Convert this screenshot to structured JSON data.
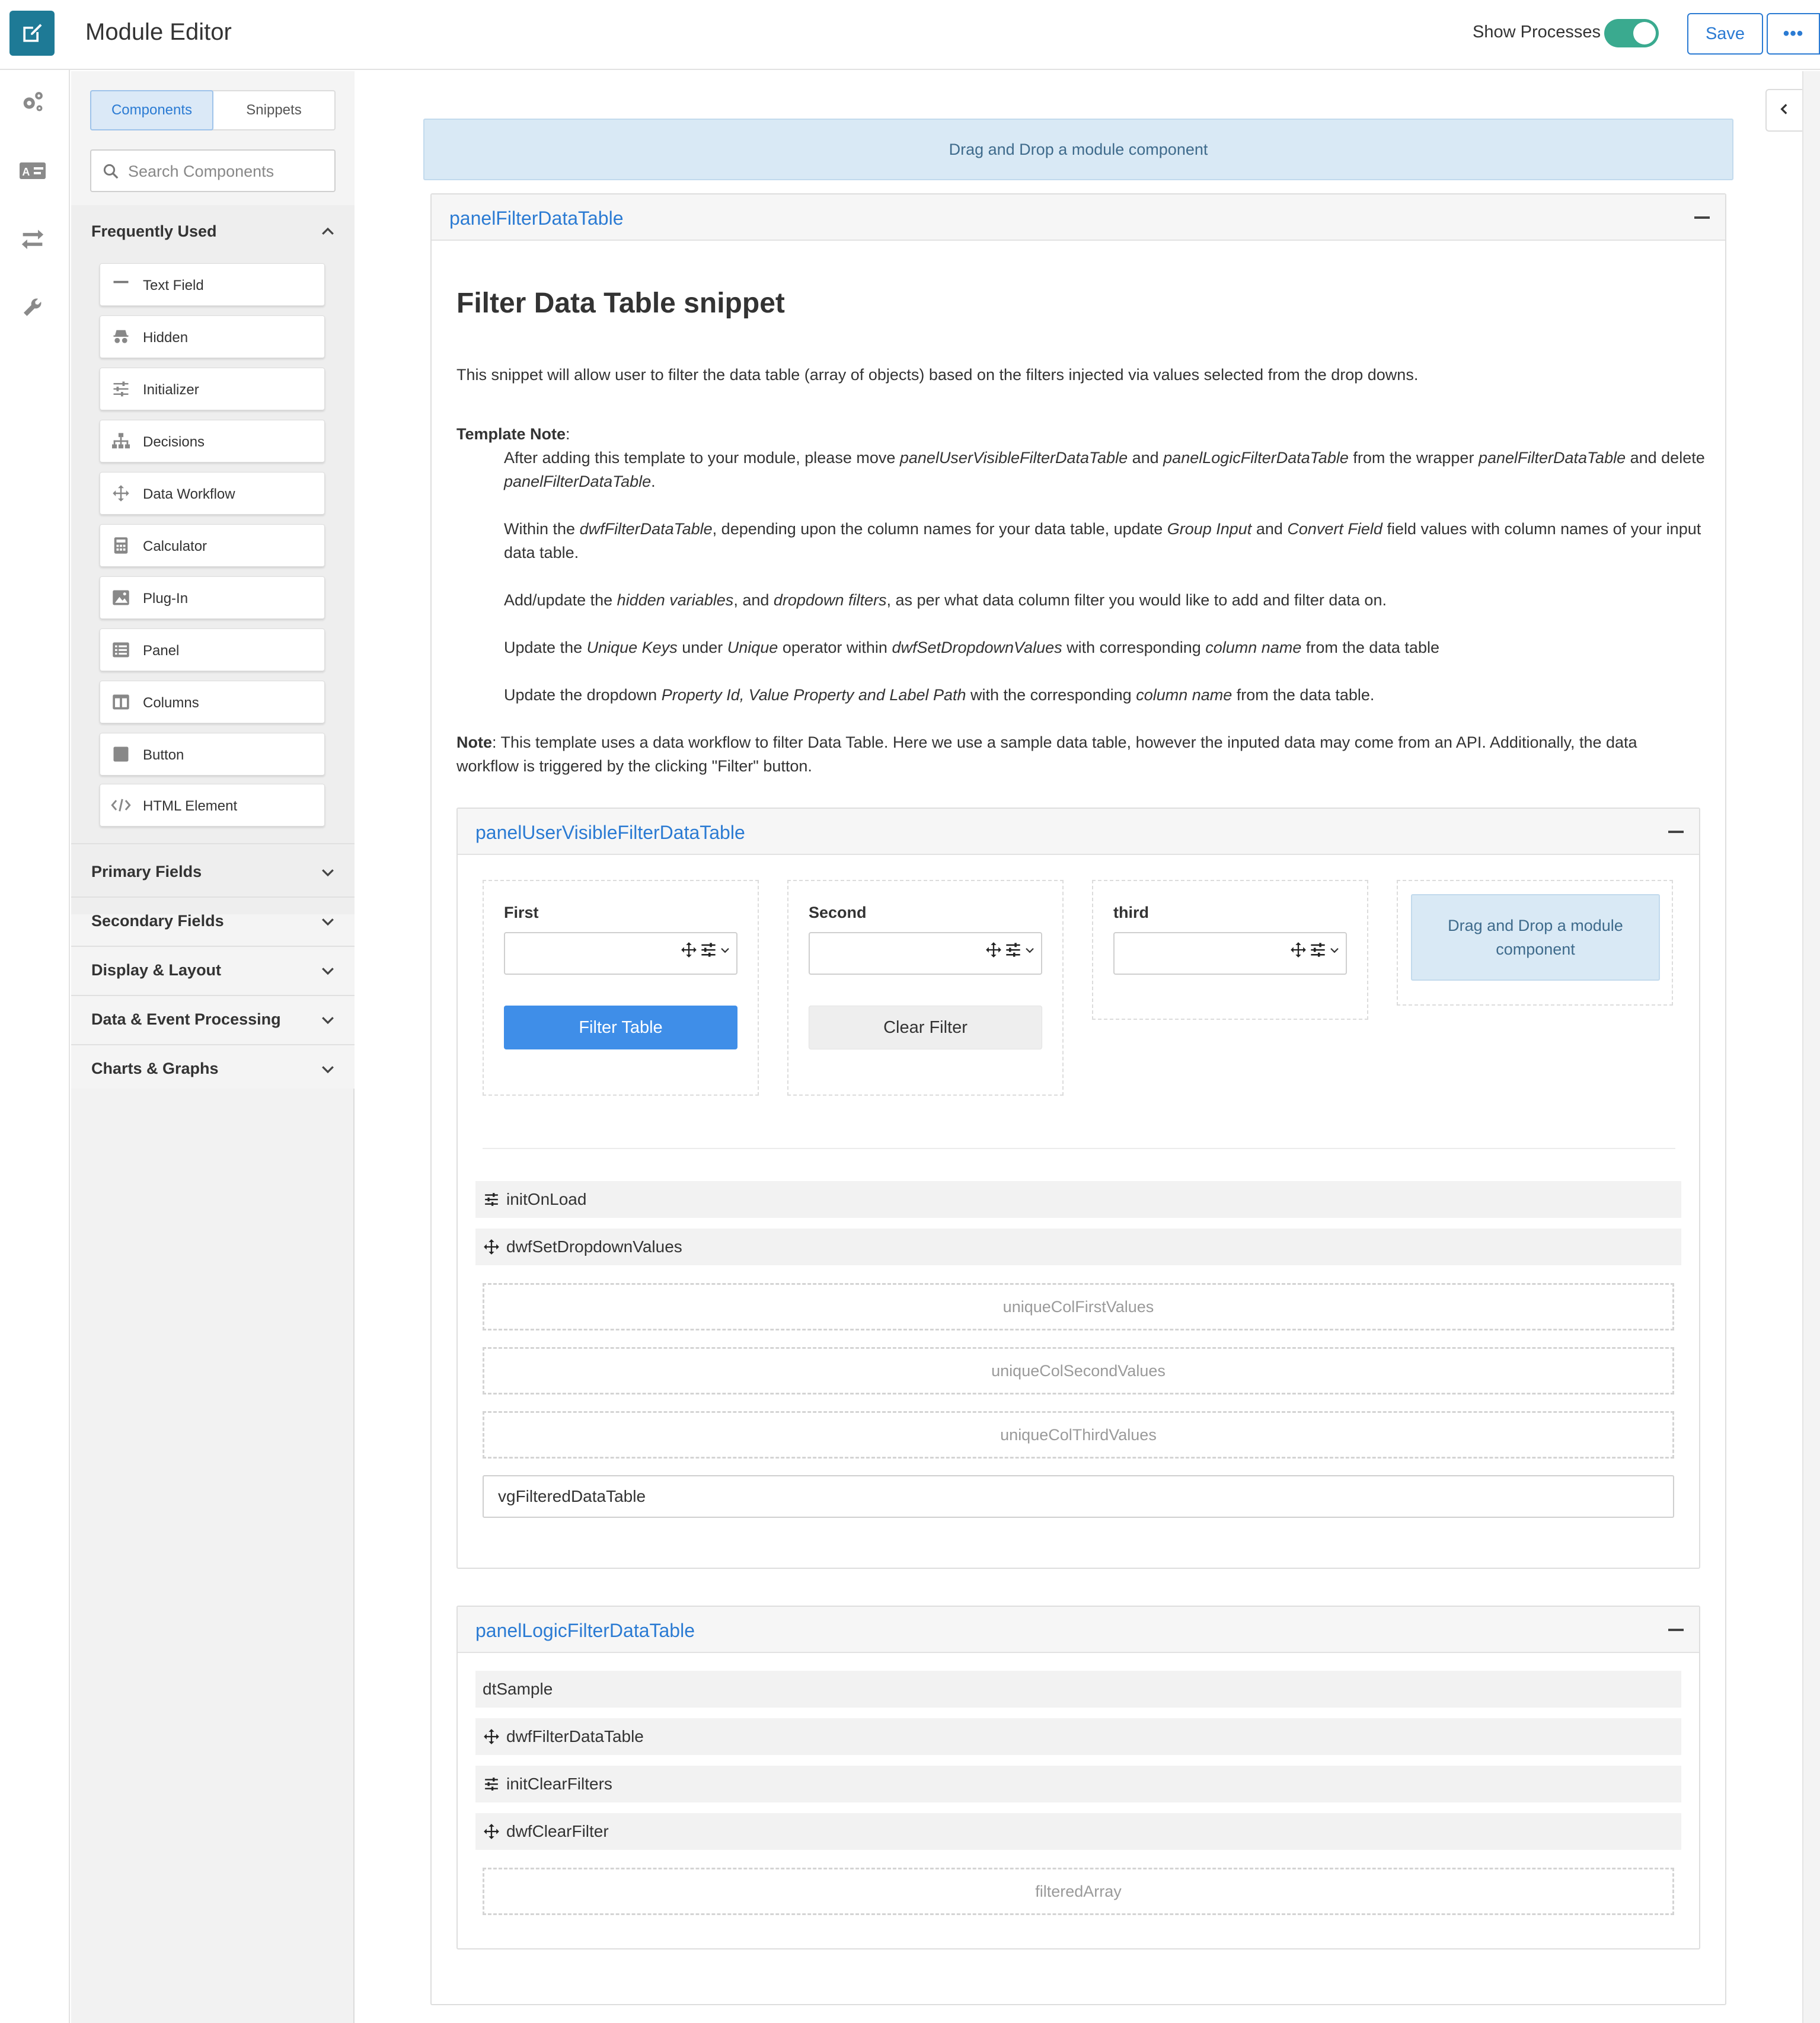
{
  "header": {
    "title": "Module Editor",
    "show_processes_label": "Show Processes",
    "show_processes_on": true,
    "save_label": "Save",
    "more_label": "•••",
    "accent_color": "#1e7a96",
    "toggle_color": "#3aaa8f"
  },
  "rail": {
    "icons": [
      "edit-icon",
      "gears-icon",
      "id-card-icon",
      "swap-arrows-icon",
      "wrench-icon"
    ]
  },
  "sidebar": {
    "tabs": {
      "components": "Components",
      "snippets": "Snippets",
      "active": "Components"
    },
    "search_placeholder": "Search Components",
    "frequently_used": {
      "label": "Frequently Used",
      "items": [
        {
          "label": "Text Field",
          "icon": "minus-icon"
        },
        {
          "label": "Hidden",
          "icon": "incognito-icon"
        },
        {
          "label": "Initializer",
          "icon": "sliders-icon"
        },
        {
          "label": "Decisions",
          "icon": "sitemap-icon"
        },
        {
          "label": "Data Workflow",
          "icon": "arrows-move-icon"
        },
        {
          "label": "Calculator",
          "icon": "calculator-icon"
        },
        {
          "label": "Plug-In",
          "icon": "image-icon"
        },
        {
          "label": "Panel",
          "icon": "list-alt-icon"
        },
        {
          "label": "Columns",
          "icon": "columns-icon"
        },
        {
          "label": "Button",
          "icon": "square-icon"
        },
        {
          "label": "HTML Element",
          "icon": "code-icon"
        }
      ]
    },
    "sections": [
      {
        "label": "Primary Fields"
      },
      {
        "label": "Secondary Fields"
      },
      {
        "label": "Display & Layout"
      },
      {
        "label": "Data & Event Processing"
      },
      {
        "label": "Charts & Graphs"
      }
    ]
  },
  "canvas": {
    "top_dropzone": "Drag and Drop a module component",
    "outer_panel": {
      "title": "panelFilterDataTable",
      "heading": "Filter Data Table snippet",
      "intro": "This snippet will allow user to filter the data table (array of objects) based on the filters injected via values selected from the drop downs.",
      "template_note_label": "Template Note",
      "note_label": "Note",
      "note_text": ": This template uses a data workflow to filter Data Table. Here we use a sample data table, however the inputed data may come from an API. Additionally, the data workflow is triggered by the clicking \"Filter\" button."
    },
    "visible_panel": {
      "title": "panelUserVisibleFilterDataTable",
      "fields": [
        {
          "label": "First"
        },
        {
          "label": "Second"
        },
        {
          "label": "third"
        }
      ],
      "filter_button": "Filter Table",
      "clear_button": "Clear Filter",
      "dropzone": "Drag and Drop a module component",
      "processes": [
        {
          "label": "initOnLoad",
          "icon": "sliders-icon"
        },
        {
          "label": "dwfSetDropdownValues",
          "icon": "arrows-move-icon"
        }
      ],
      "hidden_vars": [
        "uniqueColFirstValues",
        "uniqueColSecondValues",
        "uniqueColThirdValues"
      ],
      "vg_field": "vgFilteredDataTable"
    },
    "logic_panel": {
      "title": "panelLogicFilterDataTable",
      "processes": [
        {
          "label": "dtSample",
          "icon": ""
        },
        {
          "label": "dwfFilterDataTable",
          "icon": "arrows-move-icon"
        },
        {
          "label": "initClearFilters",
          "icon": "sliders-icon"
        },
        {
          "label": "dwfClearFilter",
          "icon": "arrows-move-icon"
        }
      ],
      "hidden_vars": [
        "filteredArray"
      ]
    }
  }
}
